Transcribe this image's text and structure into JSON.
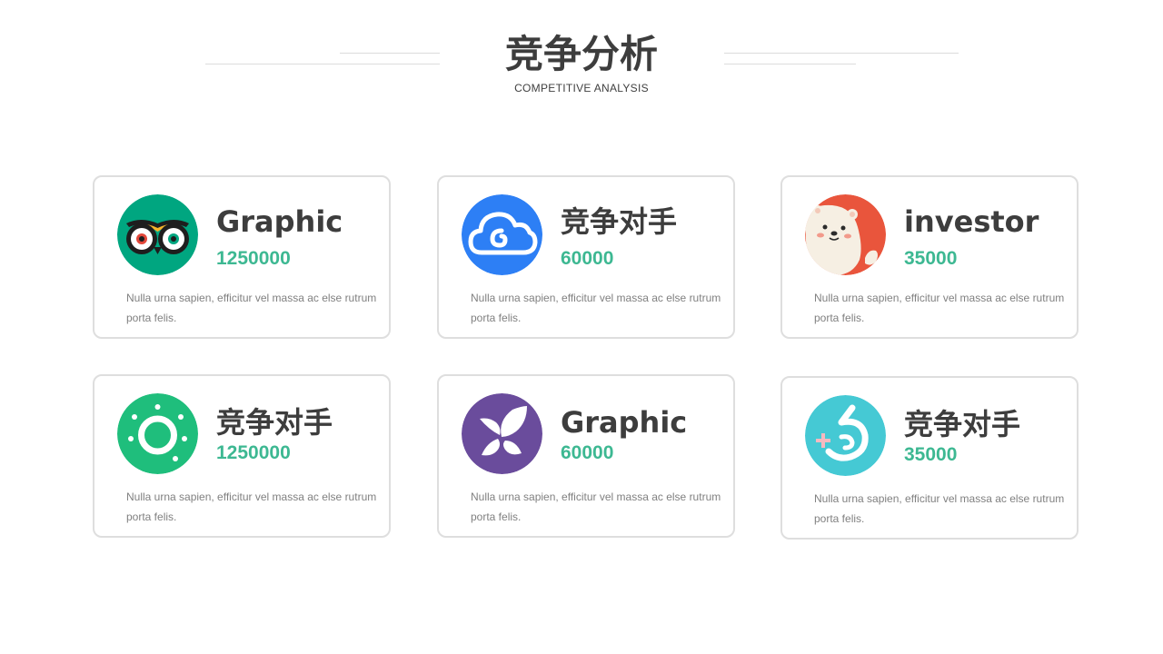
{
  "header": {
    "title": "竞争分析",
    "subtitle": "COMPETITIVE  ANALYSIS"
  },
  "cards": [
    {
      "name": "Graphic",
      "value": "1250000",
      "icon": "owl-icon",
      "color": "#00a680",
      "description": "Nulla urna sapien, efficitur vel  massa ac else rutrum porta felis."
    },
    {
      "name": "竞争对手",
      "value": "60000",
      "icon": "cloud-icon",
      "color": "#2d7ff5",
      "description": "Nulla urna sapien, efficitur vel  massa ac else rutrum porta felis."
    },
    {
      "name": "investor",
      "value": "35000",
      "icon": "bear-icon",
      "color": "#e9553c",
      "description": "Nulla urna sapien, efficitur vel  massa ac else rutrum porta felis."
    },
    {
      "name": "竞争对手",
      "value": "1250000",
      "icon": "sun-ring-icon",
      "color": "#1fbe7c",
      "description": "Nulla urna sapien, efficitur vel  massa ac else rutrum porta felis."
    },
    {
      "name": "Graphic",
      "value": "60000",
      "icon": "leaf-icon",
      "color": "#6a4c9c",
      "description": "Nulla urna sapien, efficitur vel  massa ac else rutrum porta felis."
    },
    {
      "name": "竞争对手",
      "value": "35000",
      "icon": "plus-b-icon",
      "color": "#45c9d4",
      "description": "Nulla urna sapien, efficitur vel  massa ac else rutrum porta felis."
    }
  ],
  "colors": {
    "accent": "#3db892",
    "heading": "#3d3d3d",
    "body": "#808080",
    "border": "#dedede"
  }
}
